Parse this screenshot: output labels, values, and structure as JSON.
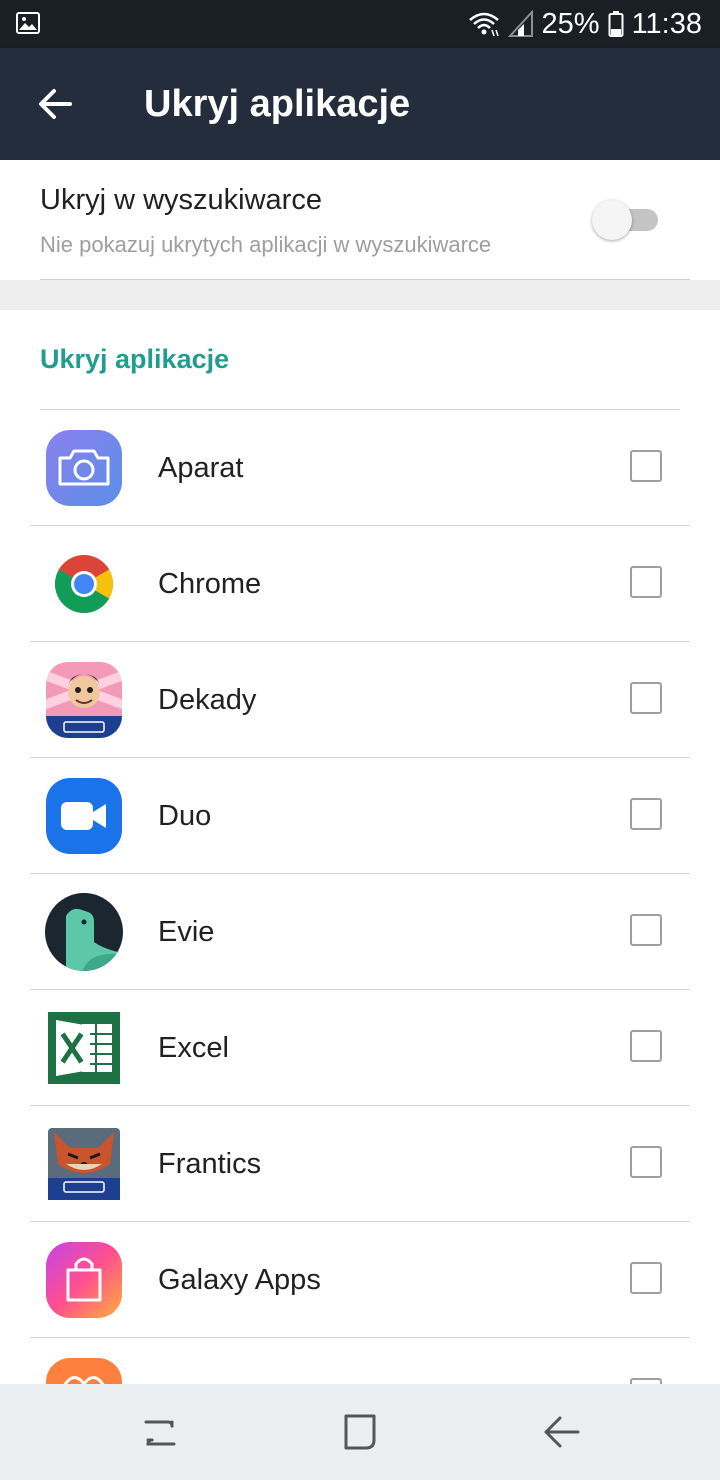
{
  "status_bar": {
    "battery": "25%",
    "time": "11:38",
    "icons": [
      "gallery-notification-icon",
      "wifi-icon",
      "signal-icon",
      "battery-icon"
    ]
  },
  "app_bar": {
    "title": "Ukryj aplikacje",
    "back_icon": "arrow-back-icon"
  },
  "search_setting": {
    "title": "Ukryj w wyszukiwarce",
    "subtitle": "Nie pokazuj ukrytych aplikacji w wyszukiwarce",
    "enabled": false
  },
  "section": {
    "header": "Ukryj aplikacje",
    "apps": [
      {
        "label": "Aparat",
        "icon": "camera-app-icon",
        "checked": false
      },
      {
        "label": "Chrome",
        "icon": "chrome-app-icon",
        "checked": false
      },
      {
        "label": "Dekady",
        "icon": "dekady-app-icon",
        "checked": false
      },
      {
        "label": "Duo",
        "icon": "duo-app-icon",
        "checked": false
      },
      {
        "label": "Evie",
        "icon": "evie-app-icon",
        "checked": false
      },
      {
        "label": "Excel",
        "icon": "excel-app-icon",
        "checked": false
      },
      {
        "label": "Frantics",
        "icon": "frantics-app-icon",
        "checked": false
      },
      {
        "label": "Galaxy Apps",
        "icon": "galaxy-apps-icon",
        "checked": false
      },
      {
        "label": "",
        "icon": "partially-visible-app-icon",
        "checked": false
      }
    ]
  },
  "nav_bar": {
    "buttons": [
      "recents-icon",
      "home-icon",
      "back-icon"
    ]
  },
  "colors": {
    "status_bar": "#1a1f26",
    "app_bar": "#232d3b",
    "accent": "#1f9e8f",
    "nav_bar": "#eceff1"
  }
}
